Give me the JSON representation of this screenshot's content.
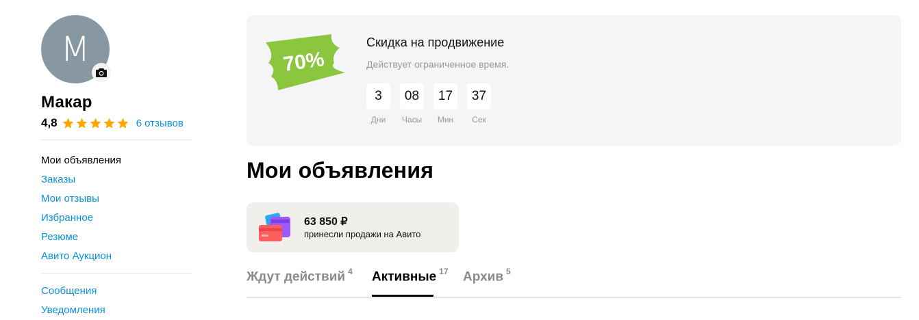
{
  "profile": {
    "avatar_letter": "M",
    "name": "Макар",
    "rating": "4,8",
    "stars": 5,
    "reviews_link": "6 отзывов"
  },
  "sidebar": {
    "items": [
      {
        "label": "Мои объявления",
        "active": true
      },
      {
        "label": "Заказы"
      },
      {
        "label": "Мои отзывы"
      },
      {
        "label": "Избранное"
      },
      {
        "label": "Резюме"
      },
      {
        "label": "Авито Аукцион"
      }
    ],
    "items2": [
      {
        "label": "Сообщения"
      },
      {
        "label": "Уведомления"
      }
    ]
  },
  "promo": {
    "badge": "70%",
    "title": "Скидка на продвижение",
    "subtitle": "Действует ограниченное время.",
    "timer": [
      {
        "value": "3",
        "label": "Дни"
      },
      {
        "value": "08",
        "label": "Часы"
      },
      {
        "value": "17",
        "label": "Мин"
      },
      {
        "value": "37",
        "label": "Сек"
      }
    ]
  },
  "main": {
    "title": "Мои объявления",
    "sales": {
      "amount": "63 850 ₽",
      "description": "принесли продажи на Авито"
    },
    "tabs": [
      {
        "label": "Ждут действий",
        "count": "4"
      },
      {
        "label": "Активные",
        "count": "17",
        "active": true
      },
      {
        "label": "Архив",
        "count": "5"
      }
    ]
  },
  "colors": {
    "link": "#0a90d9",
    "star": "#ffa500",
    "badge_green": "#8cc63f",
    "promo_bg": "#f5f5f7",
    "sales_bg": "#f1efec"
  }
}
